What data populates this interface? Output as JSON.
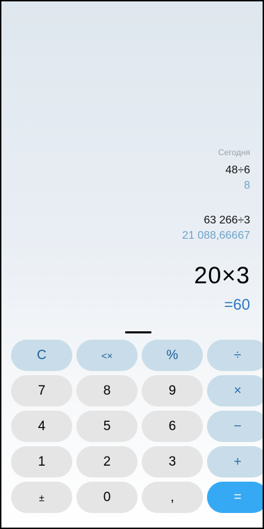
{
  "history": {
    "date_label": "Сегодня",
    "entries": [
      {
        "expression": "48÷6",
        "result": "8"
      },
      {
        "expression": "63 266÷3",
        "result": "21 088,66667"
      }
    ]
  },
  "current": {
    "expression": "20×3",
    "result": "=60"
  },
  "keys": {
    "clear": "C",
    "backspace": "<×",
    "percent": "%",
    "divide": "÷",
    "seven": "7",
    "eight": "8",
    "nine": "9",
    "multiply": "×",
    "four": "4",
    "five": "5",
    "six": "6",
    "minus": "−",
    "one": "1",
    "two": "2",
    "three": "3",
    "plus": "+",
    "sign": "±",
    "zero": "0",
    "decimal": ",",
    "equals": "="
  },
  "colors": {
    "accent": "#36a9f5",
    "function_key": "#c8dde9",
    "digit_key": "#e5e5e5",
    "result_text": "#2f78c4"
  }
}
